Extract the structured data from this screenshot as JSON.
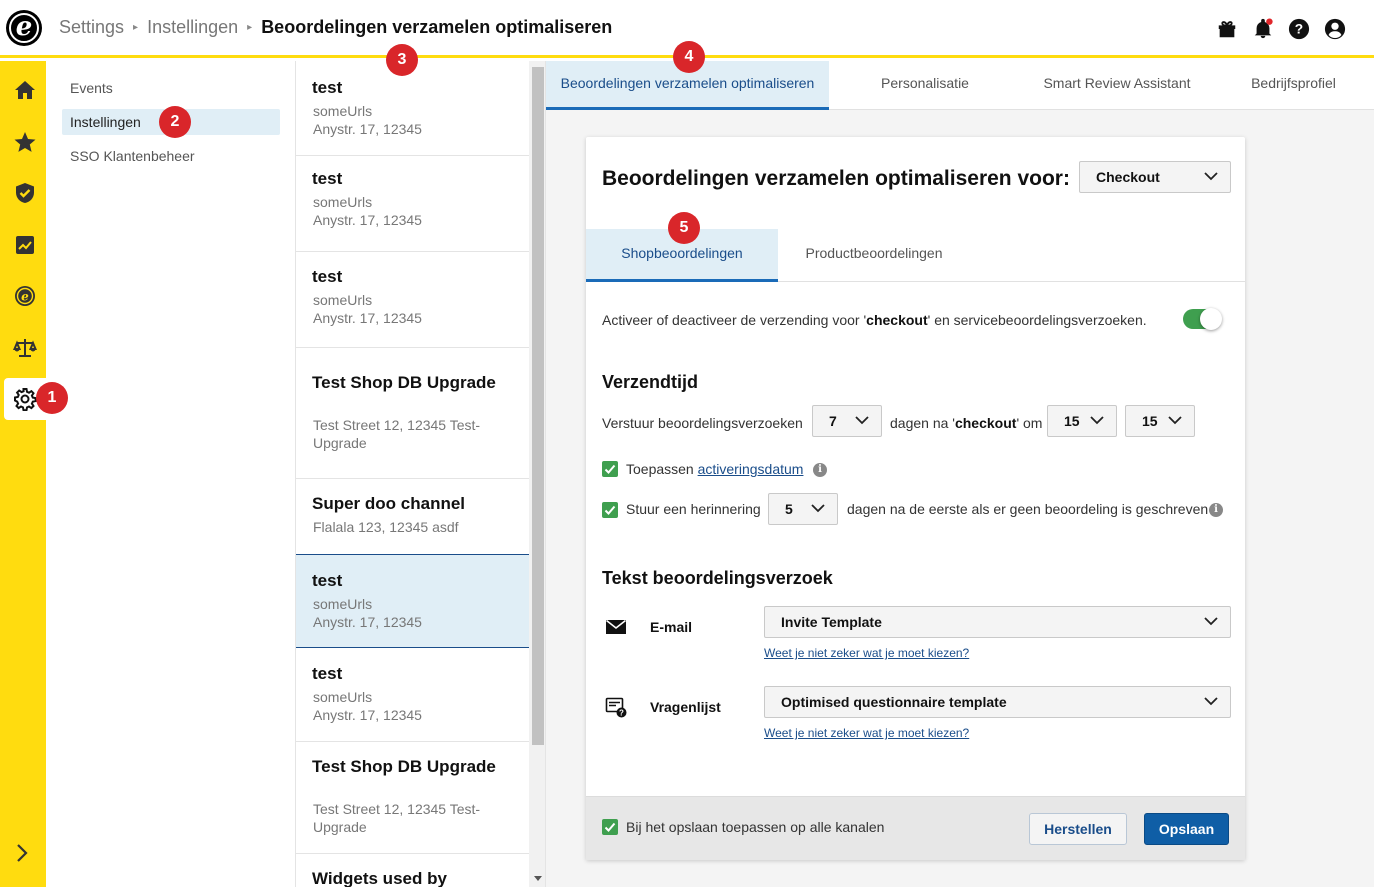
{
  "header": {
    "breadcrumb": [
      "Settings",
      "Instellingen",
      "Beoordelingen verzamelen optimaliseren"
    ],
    "icons": [
      "gift-icon",
      "bell-icon",
      "help-icon",
      "user-icon"
    ]
  },
  "rail": {
    "items": [
      "home-icon",
      "star-icon",
      "shield-icon",
      "chart-icon",
      "trustedshops-icon",
      "scales-icon",
      "gear-icon"
    ],
    "active": "gear-icon"
  },
  "subnav": {
    "items": [
      {
        "label": "Events"
      },
      {
        "label": "Instellingen"
      },
      {
        "label": "SSO Klantenbeheer"
      }
    ]
  },
  "channels": [
    {
      "title": "test",
      "line1": "someUrls",
      "line2": "Anystr. 17, 12345"
    },
    {
      "title": "test",
      "line1": "someUrls",
      "line2": "Anystr. 17, 12345"
    },
    {
      "title": "test",
      "line1": "someUrls",
      "line2": "Anystr. 17, 12345"
    },
    {
      "title": "Test Shop DB Upgrade",
      "line1": "Test Street 12, 12345 Test-",
      "line2": "Upgrade"
    },
    {
      "title": "Super doo channel",
      "line1": "Flalala 123, 12345 asdf",
      "line2": ""
    },
    {
      "title": "test",
      "line1": "someUrls",
      "line2": "Anystr. 17, 12345"
    },
    {
      "title": "test",
      "line1": "someUrls",
      "line2": "Anystr. 17, 12345"
    },
    {
      "title": "Test Shop DB Upgrade",
      "line1": "Test Street 12, 12345 Test-",
      "line2": "Upgrade"
    },
    {
      "title": "Widgets used by",
      "line1": "",
      "line2": ""
    }
  ],
  "tabs": [
    {
      "label": "Beoordelingen verzamelen optimaliseren"
    },
    {
      "label": "Personalisatie"
    },
    {
      "label": "Smart Review Assistant"
    },
    {
      "label": "Bedrijfsprofiel"
    }
  ],
  "card": {
    "title": "Beoordelingen verzamelen optimaliseren voor:",
    "trigger_select": "Checkout",
    "inner_tabs": [
      "Shopbeoordelingen",
      "Productbeoordelingen"
    ],
    "toggle_text_before": "Activeer of deactiveer de verzending voor '",
    "toggle_text_bold": "checkout",
    "toggle_text_after": "' en servicebeoordelingsverzoeken.",
    "toggle_on": true,
    "send_time": {
      "heading": "Verzendtijd",
      "label_before": "Verstuur beoordelingsverzoeken",
      "days_value": "7",
      "label_mid_before": "dagen na '",
      "label_mid_bold": "checkout",
      "label_mid_after": "' om",
      "hour_value": "15",
      "minute_value": "15",
      "apply_label": "Toepassen",
      "apply_link": "activeringsdatum",
      "apply_checked": true,
      "reminder_label": "Stuur een herinnering",
      "reminder_value": "5",
      "reminder_after": "dagen na de eerste als er geen beoordeling is geschreven",
      "reminder_checked": true
    },
    "request_text": {
      "heading": "Tekst beoordelingsverzoek",
      "email_label": "E-mail",
      "email_value": "Invite Template",
      "email_help": "Weet je niet zeker wat je moet kiezen?",
      "questionnaire_label": "Vragenlijst",
      "questionnaire_value": "Optimised questionnaire template",
      "questionnaire_help": "Weet je niet zeker wat je moet kiezen?"
    },
    "footer": {
      "apply_all_label": "Bij het opslaan toepassen op alle kanalen",
      "apply_all_checked": true,
      "reset_label": "Herstellen",
      "save_label": "Opslaan"
    }
  },
  "markers": [
    "1",
    "2",
    "3",
    "4",
    "5"
  ],
  "colors": {
    "brand_yellow": "#ffdc0f",
    "accent_blue": "#1a6bb8",
    "success_green": "#3f9f4f",
    "marker_red": "#d9262a"
  }
}
